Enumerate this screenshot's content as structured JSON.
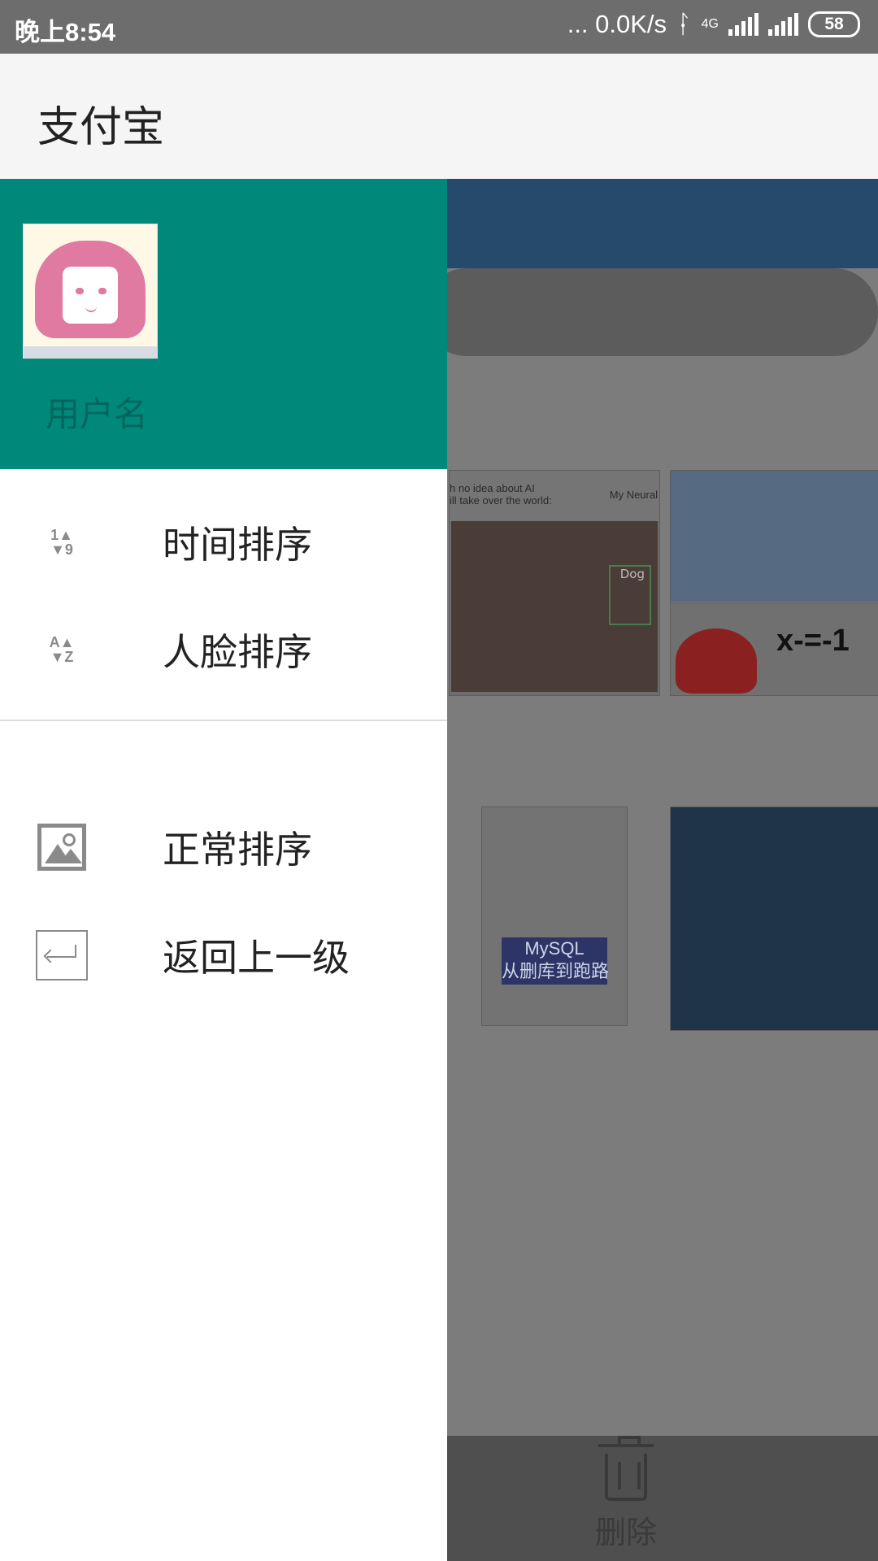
{
  "status_bar": {
    "time": "晚上8:54",
    "network_speed": "... 0.0K/s",
    "network_type": "4G",
    "battery": "58"
  },
  "app_bar": {
    "title": "支付宝"
  },
  "drawer": {
    "username": "用户名",
    "menu": [
      {
        "label": "时间排序",
        "icon": "sort-numeric-icon"
      },
      {
        "label": "人脸排序",
        "icon": "sort-alpha-icon"
      },
      {
        "label": "正常排序",
        "icon": "image-icon"
      },
      {
        "label": "返回上一级",
        "icon": "return-icon"
      }
    ]
  },
  "background": {
    "thumb_1_caption_left": "h no idea about AI\nill take over the world:",
    "thumb_1_caption_right": "My Neural",
    "thumb_1_tag": "Dog",
    "thumb_2_text": "x-=-1",
    "thumb_3_title": "MySQL\n从删库到跑路",
    "delete_label": "删除"
  },
  "colors": {
    "drawer_header": "#00897b",
    "scrim": "#7c7c7c",
    "main_toolbar": "#254a6b"
  }
}
